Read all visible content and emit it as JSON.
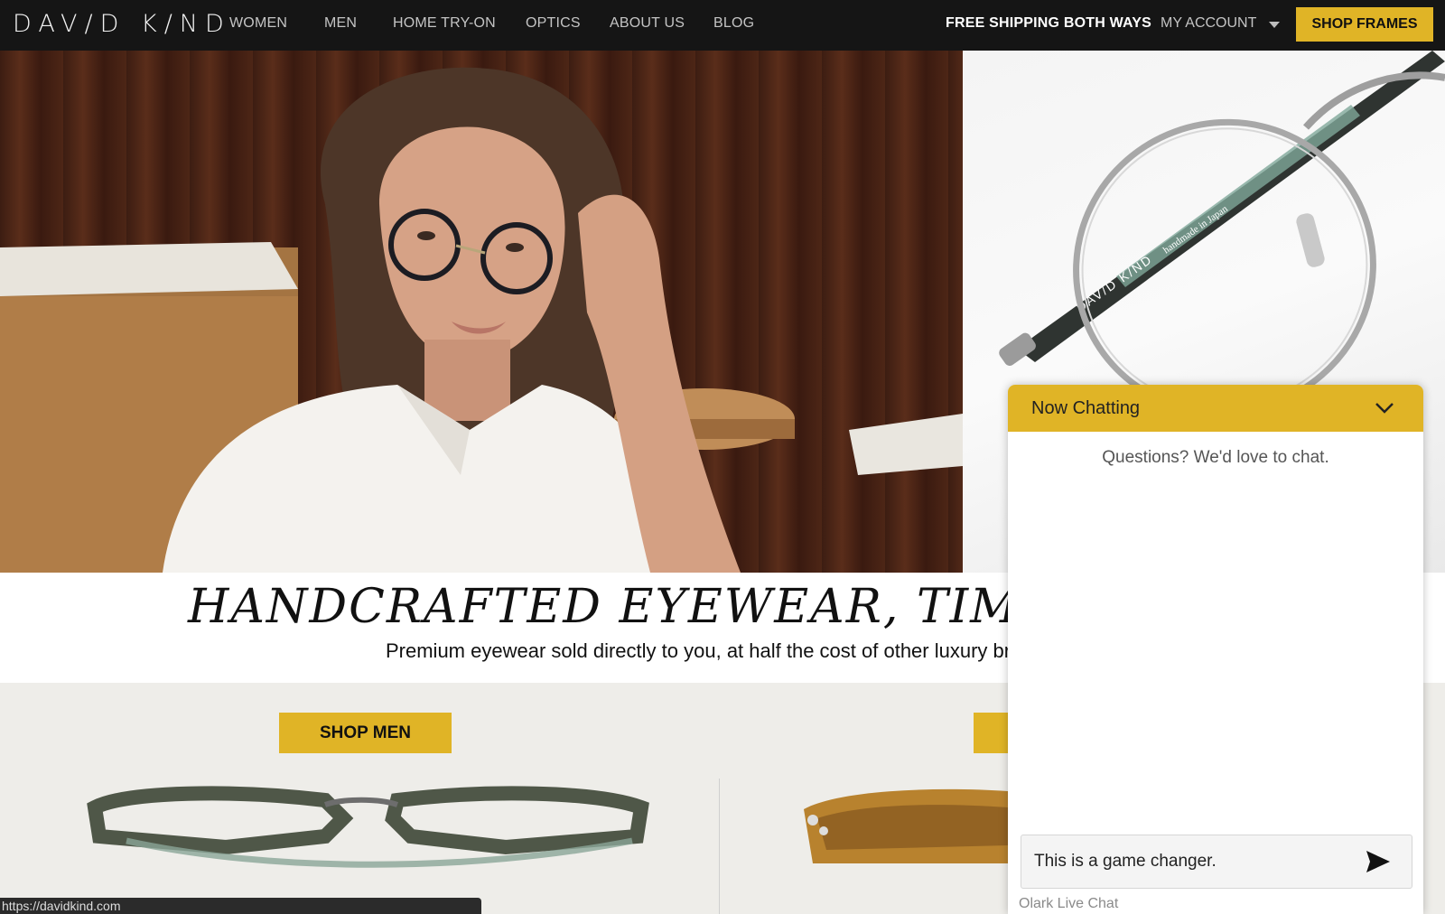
{
  "nav": {
    "logo": "DAV/D K/ND",
    "links": [
      "WOMEN",
      "MEN",
      "HOME TRY-ON",
      "OPTICS",
      "ABOUT US",
      "BLOG"
    ],
    "shipping": "FREE SHIPPING BOTH WAYS",
    "account": "MY ACCOUNT",
    "shop_frames": "SHOP FRAMES"
  },
  "hero": {
    "headline": "HANDCRAFTED EYEWEAR, TIMELE",
    "subline": "Premium eyewear sold directly to you, at half the cost of other luxury br",
    "frame_engraving": "DAV/D K/ND",
    "frame_engraving_2": "handmade in Japan"
  },
  "sections": {
    "shop_men": "SHOP MEN"
  },
  "status_url": "https://davidkind.com",
  "chat": {
    "title": "Now Chatting",
    "intro": "Questions? We'd love to chat.",
    "input_value": "This is a game changer.",
    "brand": "Olark Live Chat"
  },
  "colors": {
    "accent": "#e0b426",
    "nav_bg": "#151515"
  }
}
